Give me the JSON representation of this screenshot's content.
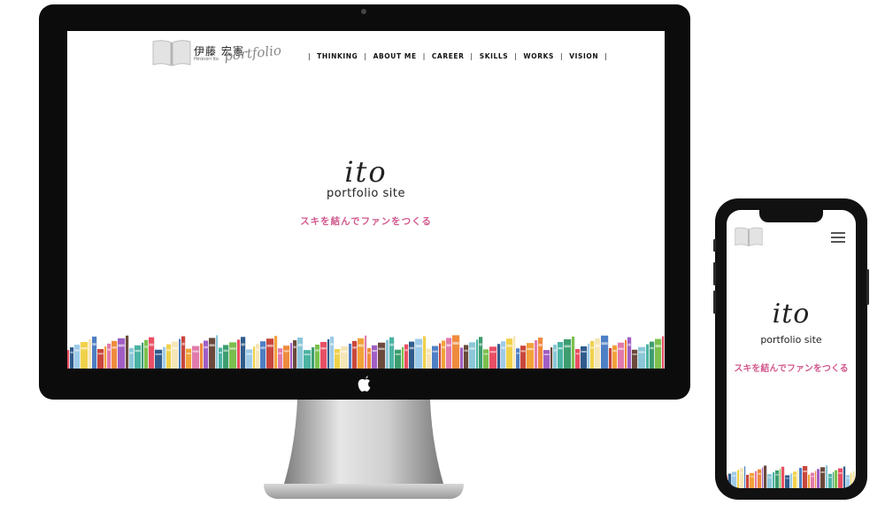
{
  "desktop": {
    "logo": {
      "name": "伊藤 宏憲",
      "sub": "Hironori Ito",
      "script": "portfolio"
    },
    "nav": [
      {
        "label": "THINKING"
      },
      {
        "label": "ABOUT ME"
      },
      {
        "label": "CAREER"
      },
      {
        "label": "SKILLS"
      },
      {
        "label": "WORKS"
      },
      {
        "label": "VISION"
      }
    ],
    "hero": {
      "title": "ito",
      "subtitle": "portfolio site",
      "tagline": "スキを結んでファンをつくる"
    }
  },
  "mobile": {
    "hero": {
      "title": "ito",
      "subtitle": "portfolio site",
      "tagline": "スキを結んでファンをつくる"
    }
  },
  "colors": {
    "accent": "#d2598e",
    "frame": "#0c0c0c",
    "text": "#222222"
  },
  "icons": {
    "apple": "apple-logo-icon",
    "menu": "hamburger-menu-icon",
    "book": "open-book-icon"
  }
}
